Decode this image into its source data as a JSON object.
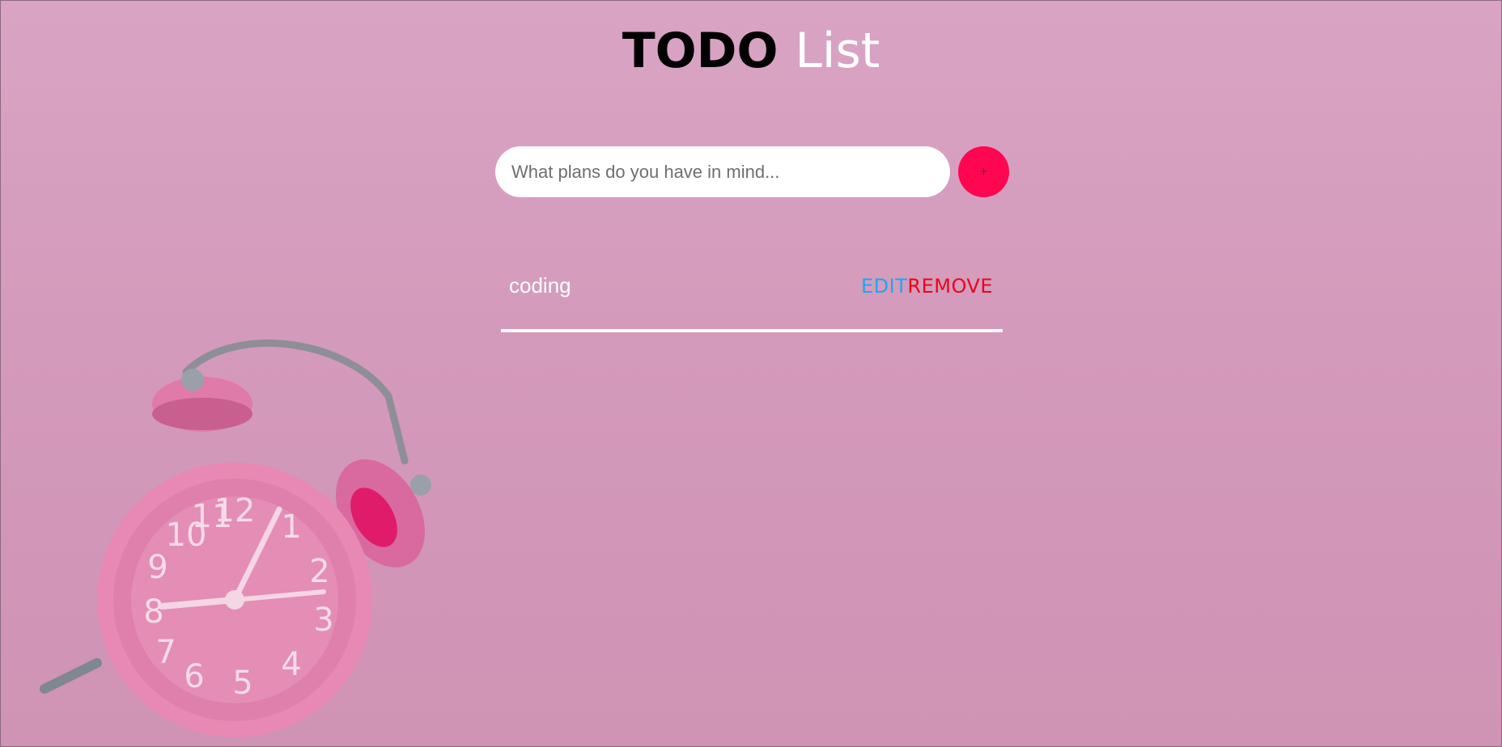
{
  "header": {
    "title_strong": "TODO",
    "title_light": "List"
  },
  "form": {
    "placeholder": "What plans do you have in mind...",
    "value": "",
    "add_label": "+"
  },
  "todos": [
    {
      "text": "coding",
      "edit_label": "EDIT",
      "remove_label": "REMOVE"
    }
  ],
  "colors": {
    "background": "#d49bbb",
    "add_button": "#ff0650",
    "edit": "#1ea7f0",
    "remove": "#e8061c"
  },
  "icons": {
    "background_decoration": "alarm-clock-icon"
  }
}
